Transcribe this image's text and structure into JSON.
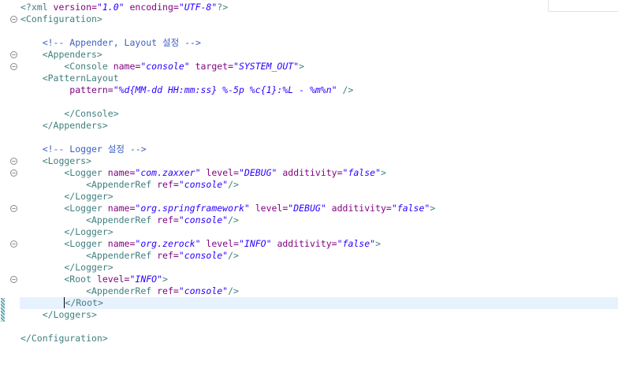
{
  "editor": {
    "lines": [
      {
        "segments": [
          {
            "t": "<?xml ",
            "c": "tag"
          },
          {
            "t": "version=",
            "c": "attr"
          },
          {
            "t": "\"1.0\"",
            "c": "val"
          },
          {
            "t": " encoding=",
            "c": "attr"
          },
          {
            "t": "\"UTF-8\"",
            "c": "val"
          },
          {
            "t": "?>",
            "c": "tag"
          }
        ]
      },
      {
        "fold": true,
        "segments": [
          {
            "t": "<Configuration>",
            "c": "tag"
          }
        ]
      },
      {
        "segments": []
      },
      {
        "segments": [
          {
            "t": "    <!-- Appender, Layout 설정 -->",
            "c": "comment"
          }
        ]
      },
      {
        "fold": true,
        "segments": [
          {
            "t": "    <Appenders>",
            "c": "tag"
          }
        ]
      },
      {
        "fold": true,
        "segments": [
          {
            "t": "        <Console ",
            "c": "tag"
          },
          {
            "t": "name=",
            "c": "attr"
          },
          {
            "t": "\"console\"",
            "c": "val"
          },
          {
            "t": " target=",
            "c": "attr"
          },
          {
            "t": "\"SYSTEM_OUT\"",
            "c": "val"
          },
          {
            "t": ">",
            "c": "tag"
          }
        ]
      },
      {
        "segments": [
          {
            "t": "    <PatternLayout",
            "c": "tag"
          }
        ]
      },
      {
        "segments": [
          {
            "t": "         pattern=",
            "c": "attr"
          },
          {
            "t": "\"%d{MM-dd HH:mm:ss} %-5p %c{1}:%L - %m%n\"",
            "c": "val"
          },
          {
            "t": " />",
            "c": "tag"
          }
        ]
      },
      {
        "segments": []
      },
      {
        "segments": [
          {
            "t": "        </Console>",
            "c": "tag"
          }
        ]
      },
      {
        "segments": [
          {
            "t": "    </Appenders>",
            "c": "tag"
          }
        ]
      },
      {
        "segments": []
      },
      {
        "segments": [
          {
            "t": "    <!-- Logger 설정 -->",
            "c": "comment"
          }
        ]
      },
      {
        "fold": true,
        "segments": [
          {
            "t": "    <Loggers>",
            "c": "tag"
          }
        ]
      },
      {
        "fold": true,
        "segments": [
          {
            "t": "        <Logger ",
            "c": "tag"
          },
          {
            "t": "name=",
            "c": "attr"
          },
          {
            "t": "\"com.zaxxer\"",
            "c": "val"
          },
          {
            "t": " level=",
            "c": "attr"
          },
          {
            "t": "\"DEBUG\"",
            "c": "val"
          },
          {
            "t": " additivity=",
            "c": "attr"
          },
          {
            "t": "\"false\"",
            "c": "val"
          },
          {
            "t": ">",
            "c": "tag"
          }
        ]
      },
      {
        "segments": [
          {
            "t": "            <AppenderRef ",
            "c": "tag"
          },
          {
            "t": "ref=",
            "c": "attr"
          },
          {
            "t": "\"console\"",
            "c": "val"
          },
          {
            "t": "/>",
            "c": "tag"
          }
        ]
      },
      {
        "segments": [
          {
            "t": "        </Logger>",
            "c": "tag"
          }
        ]
      },
      {
        "fold": true,
        "segments": [
          {
            "t": "        <Logger ",
            "c": "tag"
          },
          {
            "t": "name=",
            "c": "attr"
          },
          {
            "t": "\"org.springframework\"",
            "c": "val"
          },
          {
            "t": " level=",
            "c": "attr"
          },
          {
            "t": "\"DEBUG\"",
            "c": "val"
          },
          {
            "t": " additivity=",
            "c": "attr"
          },
          {
            "t": "\"false\"",
            "c": "val"
          },
          {
            "t": ">",
            "c": "tag"
          }
        ]
      },
      {
        "segments": [
          {
            "t": "            <AppenderRef ",
            "c": "tag"
          },
          {
            "t": "ref=",
            "c": "attr"
          },
          {
            "t": "\"console\"",
            "c": "val"
          },
          {
            "t": "/>",
            "c": "tag"
          }
        ]
      },
      {
        "segments": [
          {
            "t": "        </Logger>",
            "c": "tag"
          }
        ]
      },
      {
        "fold": true,
        "segments": [
          {
            "t": "        <Logger ",
            "c": "tag"
          },
          {
            "t": "name=",
            "c": "attr"
          },
          {
            "t": "\"org.zerock\"",
            "c": "val"
          },
          {
            "t": " level=",
            "c": "attr"
          },
          {
            "t": "\"INFO\"",
            "c": "val"
          },
          {
            "t": " additivity=",
            "c": "attr"
          },
          {
            "t": "\"false\"",
            "c": "val"
          },
          {
            "t": ">",
            "c": "tag"
          }
        ]
      },
      {
        "segments": [
          {
            "t": "            <AppenderRef ",
            "c": "tag"
          },
          {
            "t": "ref=",
            "c": "attr"
          },
          {
            "t": "\"console\"",
            "c": "val"
          },
          {
            "t": "/>",
            "c": "tag"
          }
        ]
      },
      {
        "segments": [
          {
            "t": "        </Logger>",
            "c": "tag"
          }
        ]
      },
      {
        "fold": true,
        "segments": [
          {
            "t": "        <Root ",
            "c": "tag"
          },
          {
            "t": "level=",
            "c": "attr"
          },
          {
            "t": "\"INFO\"",
            "c": "val"
          },
          {
            "t": ">",
            "c": "tag"
          }
        ]
      },
      {
        "segments": [
          {
            "t": "            <AppenderRef ",
            "c": "tag"
          },
          {
            "t": "ref=",
            "c": "attr"
          },
          {
            "t": "\"console\"",
            "c": "val"
          },
          {
            "t": "/>",
            "c": "tag"
          }
        ]
      },
      {
        "current": true,
        "segments": [
          {
            "t": "        ",
            "c": "tag"
          },
          {
            "t": "<",
            "c": "tag",
            "caret": true
          },
          {
            "t": "/Root>",
            "c": "tag"
          }
        ]
      },
      {
        "segments": [
          {
            "t": "    </Loggers>",
            "c": "tag"
          }
        ]
      },
      {
        "segments": []
      },
      {
        "segments": [
          {
            "t": "</Configuration>",
            "c": "tag"
          }
        ]
      }
    ]
  },
  "colors": {
    "tag": "#3f7f7f",
    "attribute": "#7f007f",
    "value": "#2a00ff",
    "comment": "#3f5fbf",
    "current_line": "#e8f2fe"
  },
  "icons": {
    "fold": "fold-collapse-icon",
    "fold_symbol": "−"
  }
}
